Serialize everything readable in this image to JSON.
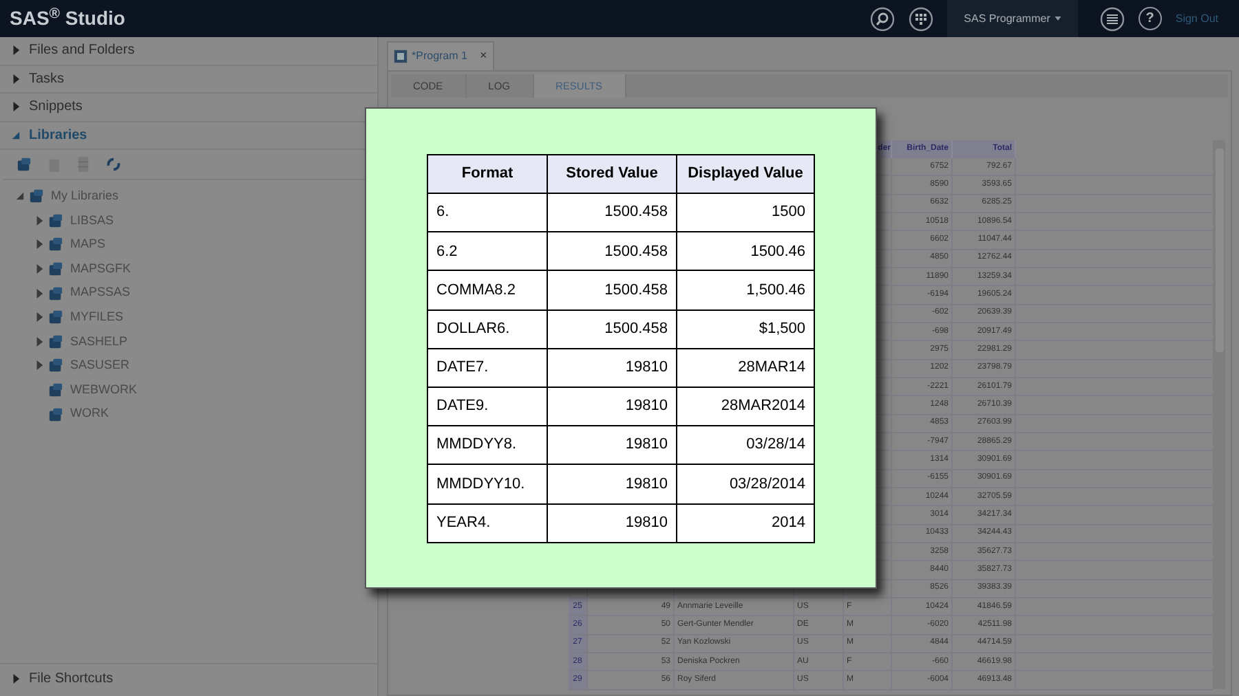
{
  "app_bar": {
    "title": "SAS$^{®}$ Studio",
    "perspective": "SAS Programmer",
    "sign_out": "Sign Out",
    "help": "?"
  },
  "sidebar": {
    "sections": [
      {
        "label": "Files and Folders",
        "expanded": false
      },
      {
        "label": "Tasks",
        "expanded": false
      },
      {
        "label": "Snippets",
        "expanded": false
      },
      {
        "label": "Libraries",
        "expanded": true
      }
    ],
    "tree": [
      {
        "label": "My Libraries",
        "expanded": true,
        "children": [
          {
            "label": "LIBSAS",
            "expanded": false
          },
          {
            "label": "MAPS",
            "expanded": false
          },
          {
            "label": "MAPSGFK",
            "expanded": false
          },
          {
            "label": "MAPSSAS",
            "expanded": false
          },
          {
            "label": "MYFILES",
            "expanded": false
          },
          {
            "label": "SASHELP",
            "expanded": false
          },
          {
            "label": "SASUSER",
            "expanded": false
          },
          {
            "label": "WEBWORK"
          },
          {
            "label": "WORK"
          }
        ]
      }
    ],
    "bottom_section": {
      "label": "File Shortcuts",
      "expanded": false
    }
  },
  "editor_tab": {
    "label": "*Program 1",
    "close": "×"
  },
  "subtabs": [
    {
      "label": "CODE",
      "selected": false
    },
    {
      "label": "LOG",
      "selected": false
    },
    {
      "label": "RESULTS",
      "selected": true
    }
  ],
  "results_table": {
    "columns": [
      "der",
      "Birth_Date",
      "Total"
    ],
    "rows": [
      {
        "birth_date": "6752",
        "total": "792.67"
      },
      {
        "birth_date": "8590",
        "total": "3593.65"
      },
      {
        "birth_date": "6632",
        "total": "6285.25"
      },
      {
        "birth_date": "10518",
        "total": "10896.54"
      },
      {
        "birth_date": "6602",
        "total": "11047.44"
      },
      {
        "birth_date": "4850",
        "total": "12762.44"
      },
      {
        "birth_date": "11890",
        "total": "13259.34"
      },
      {
        "birth_date": "-6194",
        "total": "19605.24"
      },
      {
        "birth_date": "-602",
        "total": "20639.39"
      },
      {
        "birth_date": "-698",
        "total": "20917.49"
      },
      {
        "birth_date": "2975",
        "total": "22981.29"
      },
      {
        "birth_date": "1202",
        "total": "23798.79"
      },
      {
        "birth_date": "-2221",
        "total": "26101.79"
      },
      {
        "birth_date": "1248",
        "total": "26710.39"
      },
      {
        "birth_date": "4853",
        "total": "27603.99"
      },
      {
        "birth_date": "-7947",
        "total": "28865.29"
      },
      {
        "birth_date": "1314",
        "total": "30901.69"
      },
      {
        "birth_date": "-6155",
        "total": "30901.69"
      },
      {
        "birth_date": "10244",
        "total": "32705.59"
      },
      {
        "birth_date": "3014",
        "total": "34217.34"
      },
      {
        "birth_date": "10433",
        "total": "34244.43"
      },
      {
        "birth_date": "3258",
        "total": "35627.73"
      },
      {
        "birth_date": "8440",
        "total": "35827.73"
      },
      {
        "birth_date": "8526",
        "total": "39383.39"
      },
      {
        "row": "25",
        "id": "49",
        "name": "Annmarie Leveille",
        "country": "US",
        "gender": "F",
        "birth_date": "10424",
        "total": "41846.59"
      },
      {
        "row": "26",
        "id": "50",
        "name": "Gert-Gunter Mendler",
        "country": "DE",
        "gender": "M",
        "birth_date": "-6020",
        "total": "42511.98"
      },
      {
        "row": "27",
        "id": "52",
        "name": "Yan Kozlowski",
        "country": "US",
        "gender": "M",
        "birth_date": "4844",
        "total": "44714.59"
      },
      {
        "row": "28",
        "id": "53",
        "name": "Deniska Pockren",
        "country": "AU",
        "gender": "F",
        "birth_date": "-660",
        "total": "46619.98"
      },
      {
        "row": "29",
        "id": "56",
        "name": "Roy Siferd",
        "country": "US",
        "gender": "M",
        "birth_date": "-6004",
        "total": "46913.48"
      }
    ]
  },
  "format_table": {
    "columns": [
      "Format",
      "Stored Value",
      "Displayed Value"
    ],
    "rows": [
      [
        "6.",
        "1500.458",
        "1500"
      ],
      [
        "6.2",
        "1500.458",
        "1500.46"
      ],
      [
        "COMMA8.2",
        "1500.458",
        "1,500.46"
      ],
      [
        "DOLLAR6.",
        "1500.458",
        "$1,500"
      ],
      [
        "DATE7.",
        "19810",
        "28MAR14"
      ],
      [
        "DATE9.",
        "19810",
        "28MAR2014"
      ],
      [
        "MMDDYY8.",
        "19810",
        "03/28/14"
      ],
      [
        "MMDDYY10.",
        "19810",
        "03/28/2014"
      ],
      [
        "YEAR4.",
        "19810",
        "2014"
      ]
    ]
  }
}
